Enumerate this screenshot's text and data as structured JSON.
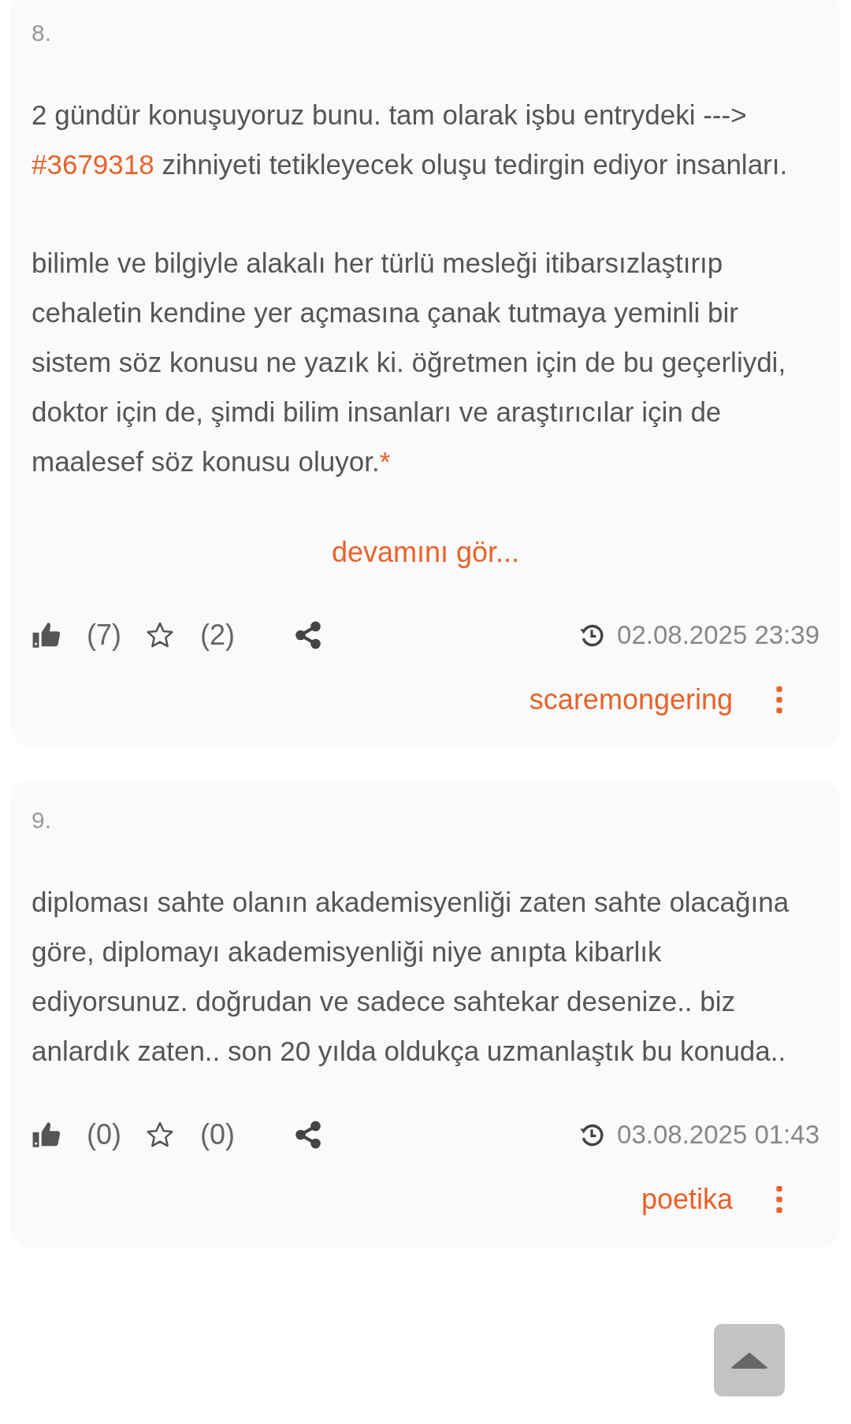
{
  "entries": [
    {
      "number": "8.",
      "paragraphs": [
        [
          {
            "kind": "text",
            "text": "2 gündür konuşuyoruz bunu. tam olarak işbu entrydeki ---> "
          },
          {
            "kind": "link",
            "text": "#3679318"
          },
          {
            "kind": "text",
            "text": " zihniyeti tetikleyecek oluşu tedirgin ediyor insanları."
          }
        ],
        [
          {
            "kind": "text",
            "text": "bilimle ve bilgiyle alakalı her türlü mesleği itibarsızlaştırıp cehaletin kendine yer açmasına çanak tutmaya yeminli bir sistem söz konusu ne yazık ki. öğretmen için de bu geçerliydi, doktor için de, şimdi bilim insanları ve araştırıcılar için de maalesef söz konusu oluyor."
          },
          {
            "kind": "link",
            "text": "*"
          }
        ]
      ],
      "more_link": "devamını gör...",
      "likes": "(7)",
      "favorites": "(2)",
      "date": "02.08.2025 23:39",
      "author": "scaremongering"
    },
    {
      "number": "9.",
      "paragraphs": [
        [
          {
            "kind": "text",
            "text": "diploması sahte olanın akademisyenliği zaten sahte olacağına göre, diplomayı akademisyenliği niye anıpta kibarlık ediyorsunuz. doğrudan ve sadece sahtekar desenize.. biz anlardık zaten.. son 20 yılda oldukça uzmanlaştık bu konuda.."
          }
        ]
      ],
      "likes": "(0)",
      "favorites": "(0)",
      "date": "03.08.2025 01:43",
      "author": "poetika"
    }
  ]
}
